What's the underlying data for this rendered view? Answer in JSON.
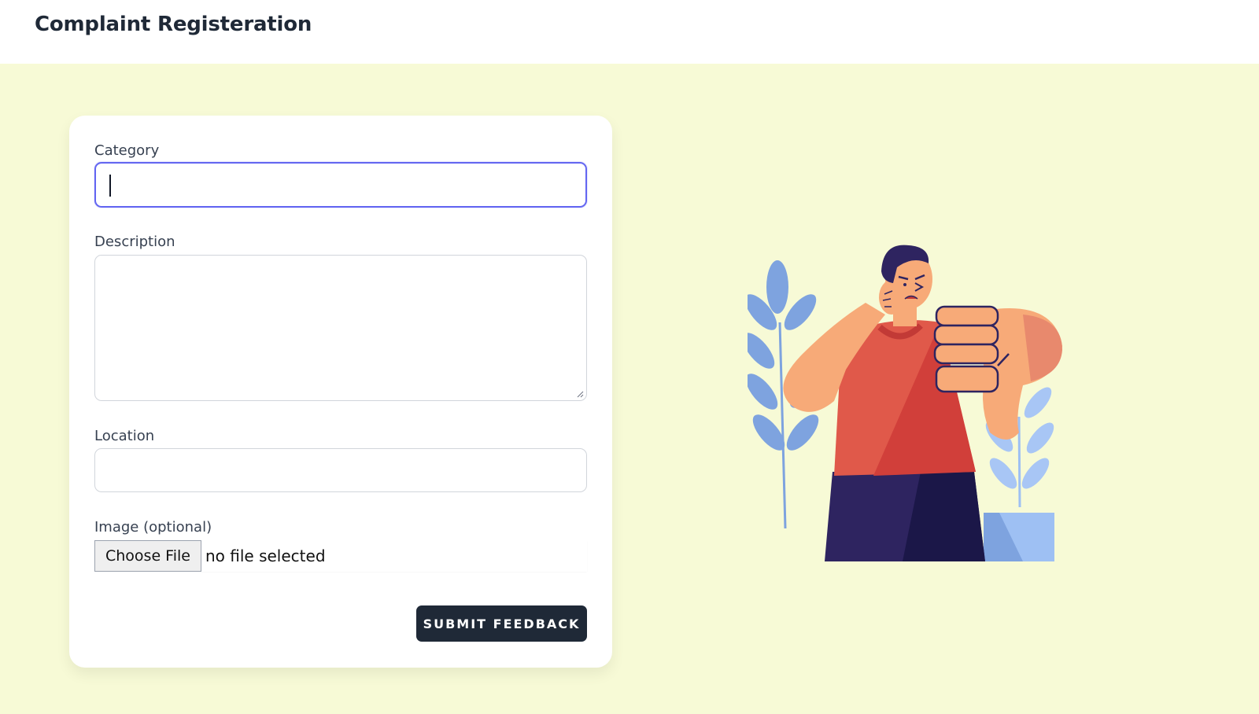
{
  "header": {
    "title": "Complaint Registeration"
  },
  "form": {
    "category": {
      "label": "Category",
      "value": ""
    },
    "description": {
      "label": "Description",
      "value": ""
    },
    "location": {
      "label": "Location",
      "value": ""
    },
    "image": {
      "label": "Image (optional)",
      "button_label": "Choose File",
      "status": "no file selected"
    },
    "submit_label": "SUBMIT FEEDBACK"
  },
  "illustration": {
    "icon": "person-thumbs-down-illustration"
  },
  "colors": {
    "page_bg": "#f7fad6",
    "accent_focus": "#6366f1",
    "button_bg": "#1f2937"
  }
}
